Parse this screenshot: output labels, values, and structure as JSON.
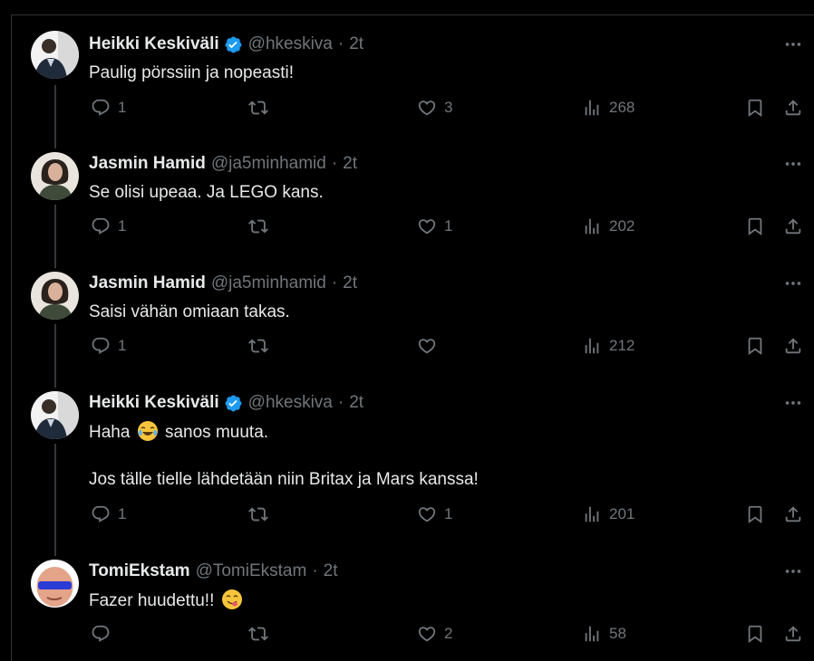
{
  "tweets": [
    {
      "name": "Heikki Keskiväli",
      "verified": true,
      "handle": "@hkeskiva",
      "time": "2t",
      "paragraphs": [
        "Paulig pörssiin ja nopeasti!"
      ],
      "replies": "1",
      "retweets": "",
      "likes": "3",
      "views": "268"
    },
    {
      "name": "Jasmin Hamid",
      "verified": false,
      "handle": "@ja5minhamid",
      "time": "2t",
      "paragraphs": [
        "Se olisi upeaa. Ja LEGO kans."
      ],
      "replies": "1",
      "retweets": "",
      "likes": "1",
      "views": "202"
    },
    {
      "name": "Jasmin Hamid",
      "verified": false,
      "handle": "@ja5minhamid",
      "time": "2t",
      "paragraphs": [
        "Saisi vähän omiaan takas."
      ],
      "replies": "1",
      "retweets": "",
      "likes": "",
      "views": "212"
    },
    {
      "name": "Heikki Keskiväli",
      "verified": true,
      "handle": "@hkeskiva",
      "time": "2t",
      "para1_before": "Haha",
      "para1_after": "sanos muuta.",
      "paragraph2": "Jos tälle tielle lähdetään niin Britax ja Mars kanssa!",
      "replies": "1",
      "retweets": "",
      "likes": "1",
      "views": "201"
    },
    {
      "name": "TomiEkstam",
      "verified": false,
      "handle": "@TomiEkstam",
      "time": "2t",
      "paragraph": "Fazer huudettu!!",
      "replies": "",
      "retweets": "",
      "likes": "2",
      "views": "58"
    }
  ],
  "separator": "·",
  "icons": [
    "reply-icon",
    "retweet-icon",
    "like-icon",
    "views-icon",
    "bookmark-icon",
    "share-icon",
    "more-icon",
    "verified-icon"
  ],
  "colors": {
    "background": "#000000",
    "text": "#e7e9ea",
    "muted": "#71767b",
    "verified": "#1d9bf0",
    "border": "#2f3336"
  }
}
